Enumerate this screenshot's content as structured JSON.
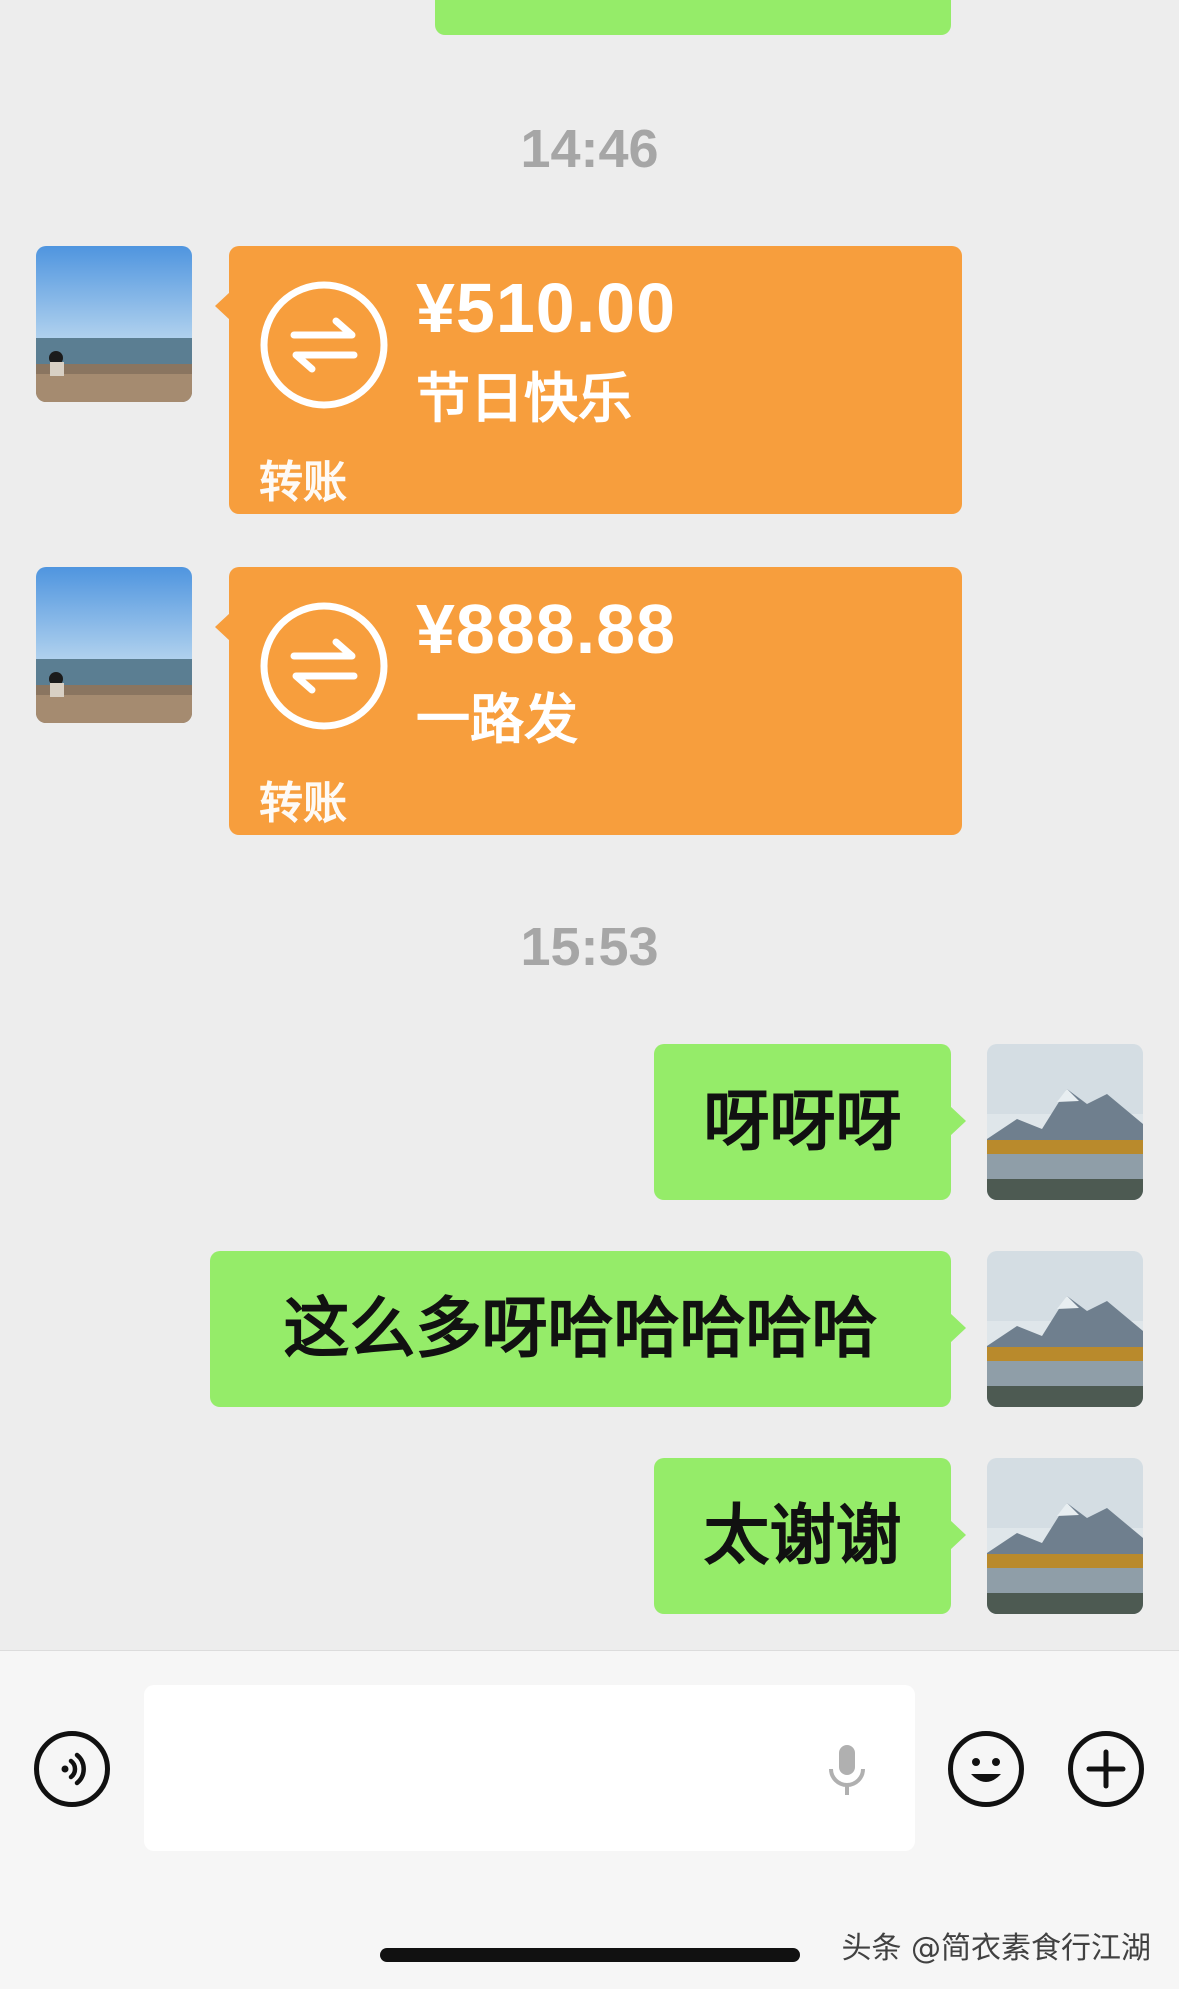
{
  "chat": {
    "timestamps": [
      "14:46",
      "15:53"
    ],
    "transfers": [
      {
        "amount": "¥510.00",
        "note": "节日快乐",
        "label": "转账"
      },
      {
        "amount": "¥888.88",
        "note": "一路发",
        "label": "转账"
      }
    ],
    "sent_messages": [
      "呀呀呀",
      "这么多呀哈哈哈哈哈",
      "太谢谢"
    ]
  },
  "input_bar": {
    "placeholder": "",
    "voice_icon": "voice-icon",
    "mic_icon": "microphone-icon",
    "emoji_icon": "emoji-icon",
    "plus_icon": "plus-icon"
  },
  "watermark": "头条 @简衣素食行江湖",
  "colors": {
    "background": "#ededed",
    "sent_bubble": "#95ec69",
    "transfer_card": "#f79e3d",
    "timestamp": "#a6a6a6"
  }
}
